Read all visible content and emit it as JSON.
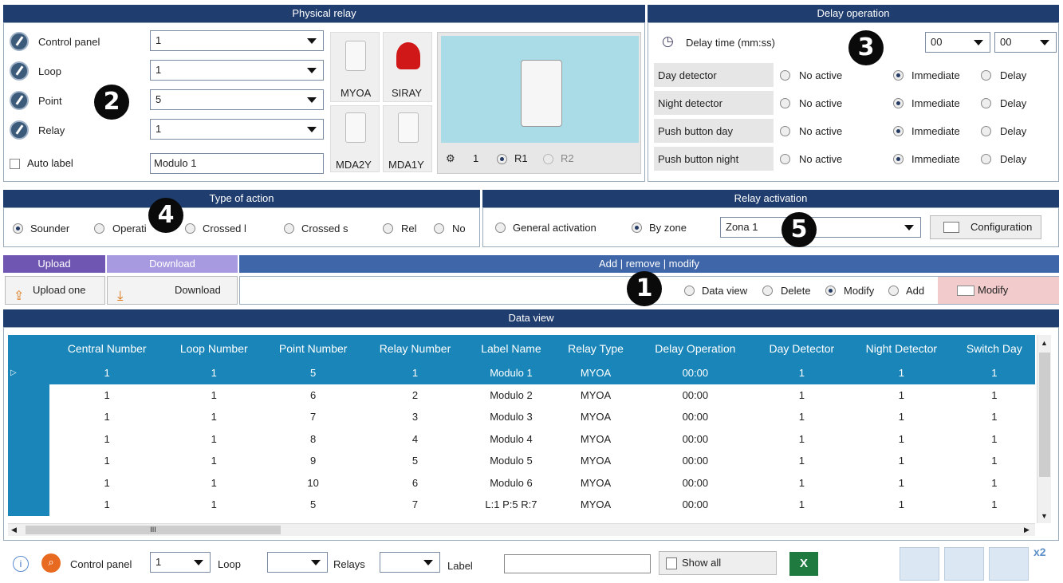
{
  "physical_relay": {
    "title": "Physical relay",
    "rows": [
      {
        "label": "Control panel",
        "value": "1"
      },
      {
        "label": "Loop",
        "value": "1"
      },
      {
        "label": "Point",
        "value": "5"
      },
      {
        "label": "Relay",
        "value": "1"
      }
    ],
    "auto_label": "Auto label",
    "auto_label_value": "Modulo 1",
    "devices": [
      "MYOA",
      "SIRAY",
      "MDA2Y",
      "MDA1Y"
    ],
    "preview_count": "1",
    "r1": "R1",
    "r2": "R2"
  },
  "delay_operation": {
    "title": "Delay operation",
    "delay_label": "Delay time (mm:ss)",
    "mm": "00",
    "ss": "00",
    "rows": [
      {
        "label": "Day detector",
        "opt1": "No active",
        "opt2": "Immediate",
        "opt3": "Delay"
      },
      {
        "label": "Night detector",
        "opt1": "No active",
        "opt2": "Immediate",
        "opt3": "Delay"
      },
      {
        "label": "Push button day",
        "opt1": "No active",
        "opt2": "Immediate",
        "opt3": "Delay"
      },
      {
        "label": "Push button night",
        "opt1": "No active",
        "opt2": "Immediate",
        "opt3": "Delay"
      }
    ]
  },
  "type_of_action": {
    "title": "Type of action",
    "options": [
      "Sounder",
      "Operati",
      "Crossed l",
      "Crossed s",
      "Rel",
      "No"
    ]
  },
  "relay_activation": {
    "title": "Relay activation",
    "general": "General activation",
    "by_zone": "By zone",
    "zone_value": "Zona 1",
    "config": "Configuration"
  },
  "upload": {
    "title": "Upload",
    "button": "Upload one"
  },
  "download": {
    "title": "Download",
    "button": "Download"
  },
  "arm": {
    "title": "Add | remove | modify",
    "opts": [
      "Data view",
      "Delete",
      "Modify",
      "Add"
    ],
    "button": "Modify"
  },
  "badges": [
    "1",
    "2",
    "3",
    "4",
    "5"
  ],
  "data_view": {
    "title": "Data view",
    "columns": [
      "Central Number",
      "Loop Number",
      "Point Number",
      "Relay Number",
      "Label Name",
      "Relay Type",
      "Delay Operation",
      "Day Detector",
      "Night Detector",
      "Switch Day"
    ],
    "rows": [
      [
        "1",
        "1",
        "5",
        "1",
        "Modulo 1",
        "MYOA",
        "00:00",
        "1",
        "1",
        "1"
      ],
      [
        "1",
        "1",
        "6",
        "2",
        "Modulo 2",
        "MYOA",
        "00:00",
        "1",
        "1",
        "1"
      ],
      [
        "1",
        "1",
        "7",
        "3",
        "Modulo 3",
        "MYOA",
        "00:00",
        "1",
        "1",
        "1"
      ],
      [
        "1",
        "1",
        "8",
        "4",
        "Modulo 4",
        "MYOA",
        "00:00",
        "1",
        "1",
        "1"
      ],
      [
        "1",
        "1",
        "9",
        "5",
        "Modulo 5",
        "MYOA",
        "00:00",
        "1",
        "1",
        "1"
      ],
      [
        "1",
        "1",
        "10",
        "6",
        "Modulo 6",
        "MYOA",
        "00:00",
        "1",
        "1",
        "1"
      ],
      [
        "1",
        "1",
        "5",
        "7",
        "L:1 P:5 R:7",
        "MYOA",
        "00:00",
        "1",
        "1",
        "1"
      ]
    ],
    "hscroll_label": "III"
  },
  "footer": {
    "control_panel": "Control panel",
    "cp_value": "1",
    "loop": "Loop",
    "relays": "Relays",
    "label": "Label",
    "show_all": "Show all",
    "x2": "x2"
  }
}
